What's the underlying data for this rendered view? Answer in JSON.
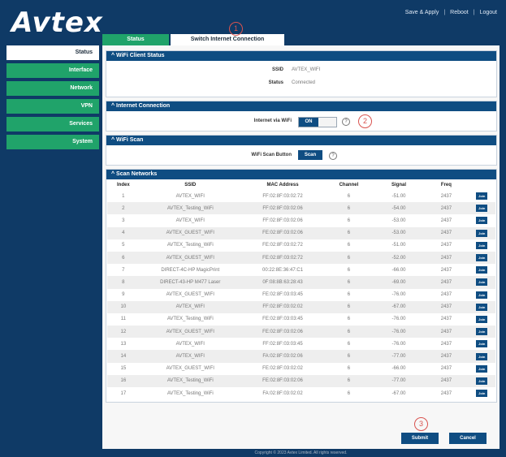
{
  "app": {
    "logo": "Avtex",
    "top_links": [
      "Save & Apply",
      "Reboot",
      "Logout"
    ]
  },
  "tabs": [
    {
      "label": "Status",
      "active": false
    },
    {
      "label": "Switch Internet Connection",
      "active": true
    }
  ],
  "sidebar": {
    "items": [
      {
        "label": "Status",
        "active": true
      },
      {
        "label": "Interface",
        "active": false
      },
      {
        "label": "Network",
        "active": false
      },
      {
        "label": "VPN",
        "active": false
      },
      {
        "label": "Services",
        "active": false
      },
      {
        "label": "System",
        "active": false
      }
    ]
  },
  "wifi_client_status": {
    "title": "WiFi Client Status",
    "ssid_label": "SSID",
    "ssid_value": "AVTEX_WIFI",
    "status_label": "Status",
    "status_value": "Connected"
  },
  "internet_connection": {
    "title": "Internet Connection",
    "label": "Internet via WiFi",
    "toggle_value": "ON",
    "help_icon": "help-icon"
  },
  "wifi_scan": {
    "title": "WiFi Scan",
    "label": "WiFi Scan Button",
    "button": "Scan",
    "help_icon": "help-icon"
  },
  "scan_networks": {
    "title": "Scan Networks",
    "columns": [
      "Index",
      "SSID",
      "MAC Address",
      "Channel",
      "Signal",
      "Freq",
      ""
    ],
    "rows": [
      {
        "index": "1",
        "ssid": "AVTEX_WIFI",
        "mac": "FF:02:8F:03:02:72",
        "channel": "6",
        "signal": "-51.00",
        "freq": "2437"
      },
      {
        "index": "2",
        "ssid": "AVTEX_Testing_WiFi",
        "mac": "FF:02:8F:03:02:06",
        "channel": "6",
        "signal": "-54.00",
        "freq": "2437"
      },
      {
        "index": "3",
        "ssid": "AVTEX_WIFI",
        "mac": "FF:02:8F:03:02:06",
        "channel": "6",
        "signal": "-53.00",
        "freq": "2437"
      },
      {
        "index": "4",
        "ssid": "AVTEX_GUEST_WIFI",
        "mac": "FE:02:8F:03:02:06",
        "channel": "6",
        "signal": "-53.00",
        "freq": "2437"
      },
      {
        "index": "5",
        "ssid": "AVTEX_Testing_WiFi",
        "mac": "FE:02:8F:03:02:72",
        "channel": "6",
        "signal": "-51.00",
        "freq": "2437"
      },
      {
        "index": "6",
        "ssid": "AVTEX_GUEST_WIFI",
        "mac": "FE:02:8F:03:02:72",
        "channel": "6",
        "signal": "-52.00",
        "freq": "2437"
      },
      {
        "index": "7",
        "ssid": "DIRECT-4C-HP MagicPrint",
        "mac": "00:22:8E:36:47:C1",
        "channel": "6",
        "signal": "-66.00",
        "freq": "2437"
      },
      {
        "index": "8",
        "ssid": "DIRECT-43-HP M477 Laser",
        "mac": "0F:08:8B:63:28:43",
        "channel": "6",
        "signal": "-69.00",
        "freq": "2437"
      },
      {
        "index": "9",
        "ssid": "AVTEX_GUEST_WIFI",
        "mac": "FE:02:8F:03:03:45",
        "channel": "6",
        "signal": "-76.00",
        "freq": "2437"
      },
      {
        "index": "10",
        "ssid": "AVTEX_WIFI",
        "mac": "FF:02:8F:03:02:02",
        "channel": "6",
        "signal": "-67.00",
        "freq": "2437"
      },
      {
        "index": "11",
        "ssid": "AVTEX_Testing_WiFi",
        "mac": "FE:02:8F:03:03:45",
        "channel": "6",
        "signal": "-76.00",
        "freq": "2437"
      },
      {
        "index": "12",
        "ssid": "AVTEX_GUEST_WIFI",
        "mac": "FE:02:8F:03:02:06",
        "channel": "6",
        "signal": "-76.00",
        "freq": "2437"
      },
      {
        "index": "13",
        "ssid": "AVTEX_WIFI",
        "mac": "FF:02:8F:03:03:45",
        "channel": "6",
        "signal": "-76.00",
        "freq": "2437"
      },
      {
        "index": "14",
        "ssid": "AVTEX_WIFI",
        "mac": "FA:02:8F:03:02:06",
        "channel": "6",
        "signal": "-77.00",
        "freq": "2437"
      },
      {
        "index": "15",
        "ssid": "AVTEX_GUEST_WIFI",
        "mac": "FE:02:8F:03:02:02",
        "channel": "6",
        "signal": "-66.00",
        "freq": "2437"
      },
      {
        "index": "16",
        "ssid": "AVTEX_Testing_WiFi",
        "mac": "FE:02:8F:03:02:06",
        "channel": "6",
        "signal": "-77.00",
        "freq": "2437"
      },
      {
        "index": "17",
        "ssid": "AVTEX_Testing_WiFi",
        "mac": "FA:02:8F:03:02:02",
        "channel": "6",
        "signal": "-67.00",
        "freq": "2437"
      }
    ],
    "join_label": "Join"
  },
  "actions": {
    "submit": "Submit",
    "cancel": "Cancel"
  },
  "annotations": [
    "1",
    "2",
    "3"
  ],
  "footer": "Copyright © 2023 Avtex Limited. All rights reserved.",
  "colors": {
    "frame": "#0f3a66",
    "header": "#0f4d82",
    "accent_green": "#20a36a",
    "marker_red": "#d9534f"
  }
}
